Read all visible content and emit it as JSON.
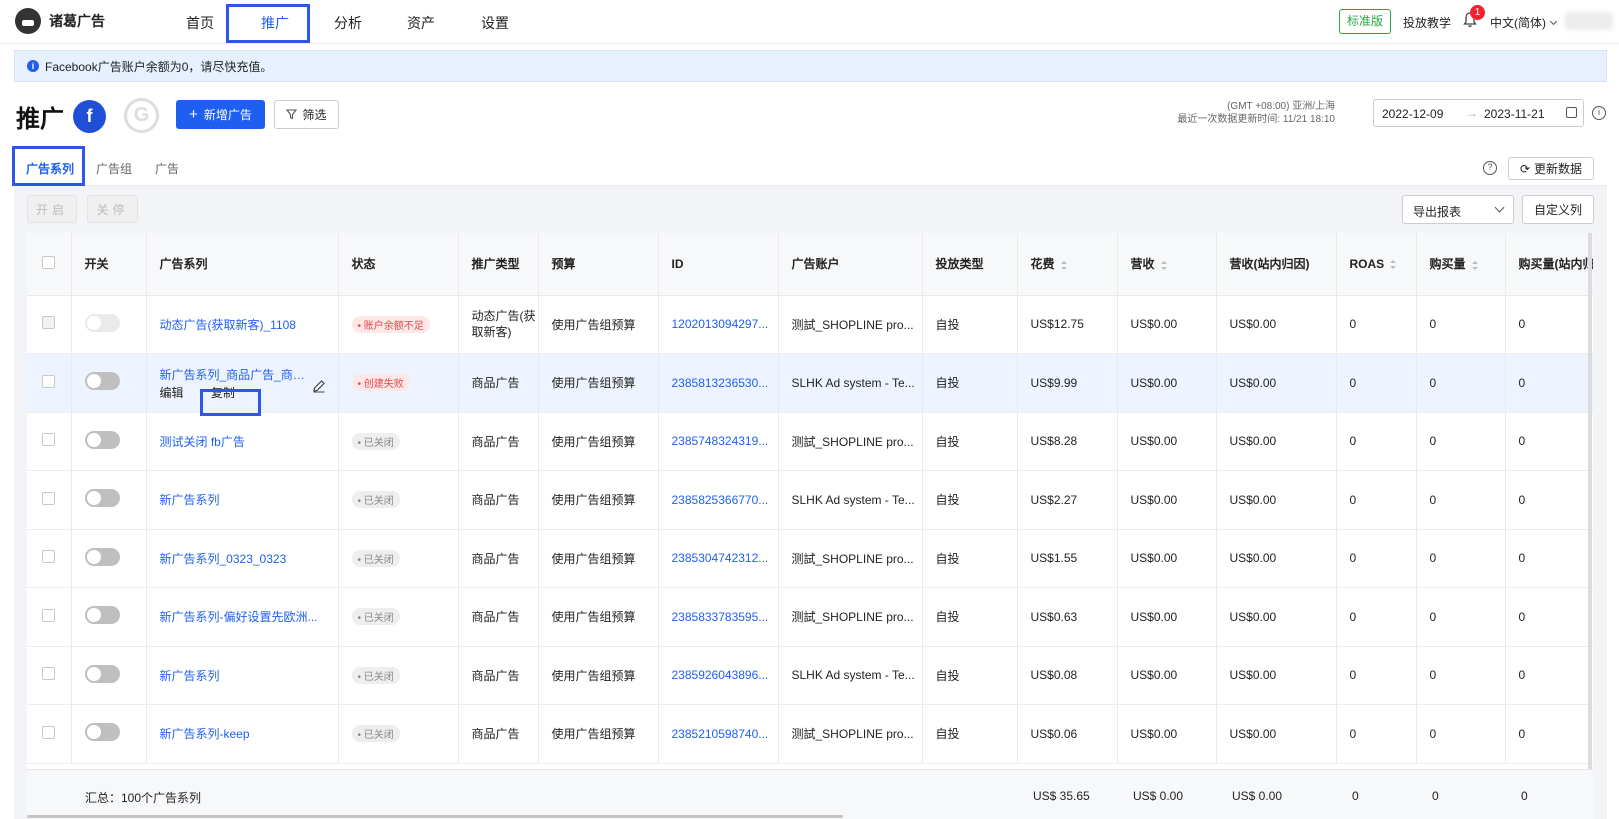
{
  "app": {
    "name": "诸葛广告"
  },
  "nav": {
    "items": [
      "首页",
      "推广",
      "分析",
      "资产",
      "设置"
    ],
    "active": "推广"
  },
  "topright": {
    "plan_badge": "标准版",
    "tutorial": "投放教学",
    "notif_count": "1",
    "language": "中文(简体)"
  },
  "alert": {
    "text": "Facebook广告账户余额为0，请尽快充值。"
  },
  "header": {
    "title": "推广",
    "fb_letter": "f",
    "g_letter": "G",
    "add_label": "新增广告",
    "filter_label": "筛选",
    "timezone": "(GMT +08:00) 亚洲/上海",
    "last_update": "最近一次数据更新时间: 11/21 18:10",
    "date_start": "2022-12-09",
    "date_end": "2023-11-21"
  },
  "tabs": [
    "广告系列",
    "广告组",
    "广告"
  ],
  "toolbar": {
    "refresh": "更新数据",
    "enable": "开启",
    "disable": "关停",
    "export": "导出报表",
    "custom_cols": "自定义列"
  },
  "table": {
    "columns": [
      "开关",
      "广告系列",
      "状态",
      "推广类型",
      "预算",
      "ID",
      "广告账户",
      "投放类型",
      "花费",
      "营收",
      "营收(站内归因)",
      "ROAS",
      "购买量",
      "购买量(站内归因)"
    ],
    "rows": [
      {
        "name": "动态广告(获取新客)_1108",
        "status": "账户余额不足",
        "type": "动态广告(获取新客)",
        "budget": "使用广告组预算",
        "id": "1202013094297...",
        "account": "测試_SHOPLINE pro...",
        "delivery": "自投",
        "spend": "US$12.75",
        "revenue": "US$0.00",
        "rev_attr": "US$0.00",
        "roas": "0",
        "purchases": "0",
        "purch_attr": "0"
      },
      {
        "name": "新广告系列_商品广告_商品...",
        "status": "创建失败",
        "type": "商品广告",
        "budget": "使用广告组预算",
        "id": "2385813236530...",
        "account": "SLHK Ad system - Te...",
        "delivery": "自投",
        "spend": "US$9.99",
        "revenue": "US$0.00",
        "rev_attr": "US$0.00",
        "roas": "0",
        "purchases": "0",
        "purch_attr": "0",
        "action_edit": "编辑",
        "action_copy": "复制"
      },
      {
        "name": "测试关闭 fb广告",
        "status": "已关闭",
        "type": "商品广告",
        "budget": "使用广告组预算",
        "id": "2385748324319...",
        "account": "测試_SHOPLINE pro...",
        "delivery": "自投",
        "spend": "US$8.28",
        "revenue": "US$0.00",
        "rev_attr": "US$0.00",
        "roas": "0",
        "purchases": "0",
        "purch_attr": "0"
      },
      {
        "name": "新广告系列",
        "status": "已关闭",
        "type": "商品广告",
        "budget": "使用广告组预算",
        "id": "2385825366770...",
        "account": "SLHK Ad system - Te...",
        "delivery": "自投",
        "spend": "US$2.27",
        "revenue": "US$0.00",
        "rev_attr": "US$0.00",
        "roas": "0",
        "purchases": "0",
        "purch_attr": "0"
      },
      {
        "name": "新广告系列_0323_0323",
        "status": "已关闭",
        "type": "商品广告",
        "budget": "使用广告组预算",
        "id": "2385304742312...",
        "account": "测試_SHOPLINE pro...",
        "delivery": "自投",
        "spend": "US$1.55",
        "revenue": "US$0.00",
        "rev_attr": "US$0.00",
        "roas": "0",
        "purchases": "0",
        "purch_attr": "0"
      },
      {
        "name": "新广告系列-偏好设置先欧洲...",
        "status": "已关闭",
        "type": "商品广告",
        "budget": "使用广告组预算",
        "id": "2385833783595...",
        "account": "测試_SHOPLINE pro...",
        "delivery": "自投",
        "spend": "US$0.63",
        "revenue": "US$0.00",
        "rev_attr": "US$0.00",
        "roas": "0",
        "purchases": "0",
        "purch_attr": "0"
      },
      {
        "name": "新广告系列",
        "status": "已关闭",
        "type": "商品广告",
        "budget": "使用广告组预算",
        "id": "2385926043896...",
        "account": "SLHK Ad system - Te...",
        "delivery": "自投",
        "spend": "US$0.08",
        "revenue": "US$0.00",
        "rev_attr": "US$0.00",
        "roas": "0",
        "purchases": "0",
        "purch_attr": "0"
      },
      {
        "name": "新广告系列-keep",
        "status": "已关闭",
        "type": "商品广告",
        "budget": "使用广告组预算",
        "id": "2385210598740...",
        "account": "测試_SHOPLINE pro...",
        "delivery": "自投",
        "spend": "US$0.06",
        "revenue": "US$0.00",
        "rev_attr": "US$0.00",
        "roas": "0",
        "purchases": "0",
        "purch_attr": "0"
      }
    ],
    "summary": {
      "label": "汇总：100个广告系列",
      "spend": "US$ 35.65",
      "revenue": "US$ 0.00",
      "rev_attr": "US$ 0.00",
      "roas": "0",
      "purchases": "0",
      "purch_attr": "0"
    }
  }
}
